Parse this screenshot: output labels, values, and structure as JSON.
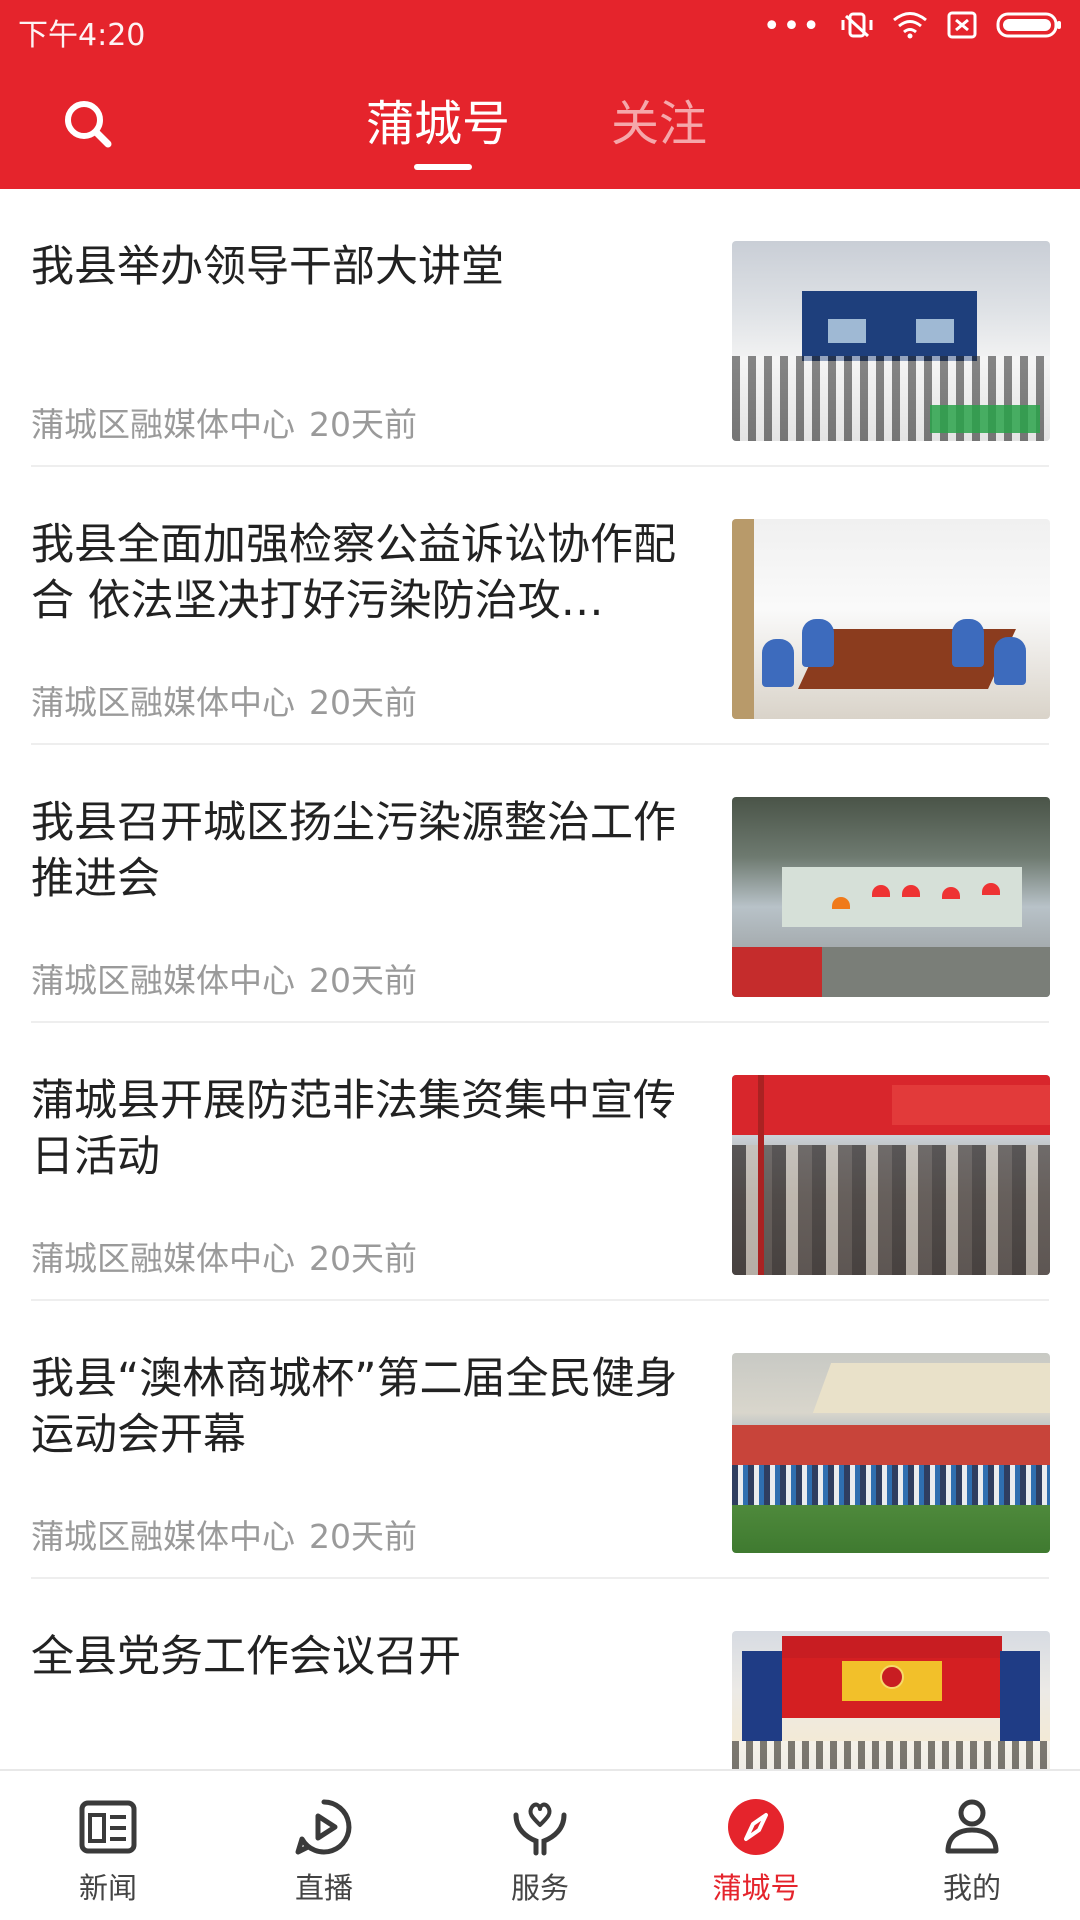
{
  "status_bar": {
    "time": "下午4:20",
    "icons": [
      "more-dots-icon",
      "mute-vibrate-icon",
      "wifi-icon",
      "no-sim-icon",
      "battery-icon"
    ]
  },
  "header": {
    "search_icon": "search-icon",
    "tabs": [
      {
        "label": "蒲城号",
        "active": true
      },
      {
        "label": "关注",
        "active": false
      }
    ],
    "accent_color": "#e5242c"
  },
  "articles": [
    {
      "title": "我县举办领导干部大讲堂",
      "source": "蒲城区融媒体中心",
      "time": "20天前"
    },
    {
      "title": "我县全面加强检察公益诉讼协作配合 依法坚决打好污染防治攻…",
      "source": "蒲城区融媒体中心",
      "time": "20天前"
    },
    {
      "title": "我县召开城区扬尘污染源整治工作推进会",
      "source": "蒲城区融媒体中心",
      "time": "20天前"
    },
    {
      "title": "蒲城县开展防范非法集资集中宣传日活动",
      "source": "蒲城区融媒体中心",
      "time": "20天前"
    },
    {
      "title": "我县“澳林商城杯”第二届全民健身运动会开幕",
      "source": "蒲城区融媒体中心",
      "time": "20天前"
    },
    {
      "title": "全县党务工作会议召开",
      "source": "",
      "time": ""
    }
  ],
  "bottom_nav": [
    {
      "label": "新闻",
      "icon": "newspaper-icon",
      "active": false
    },
    {
      "label": "直播",
      "icon": "play-circle-icon",
      "active": false
    },
    {
      "label": "服务",
      "icon": "heart-hands-icon",
      "active": false
    },
    {
      "label": "蒲城号",
      "icon": "compass-icon",
      "active": true
    },
    {
      "label": "我的",
      "icon": "user-icon",
      "active": false
    }
  ]
}
